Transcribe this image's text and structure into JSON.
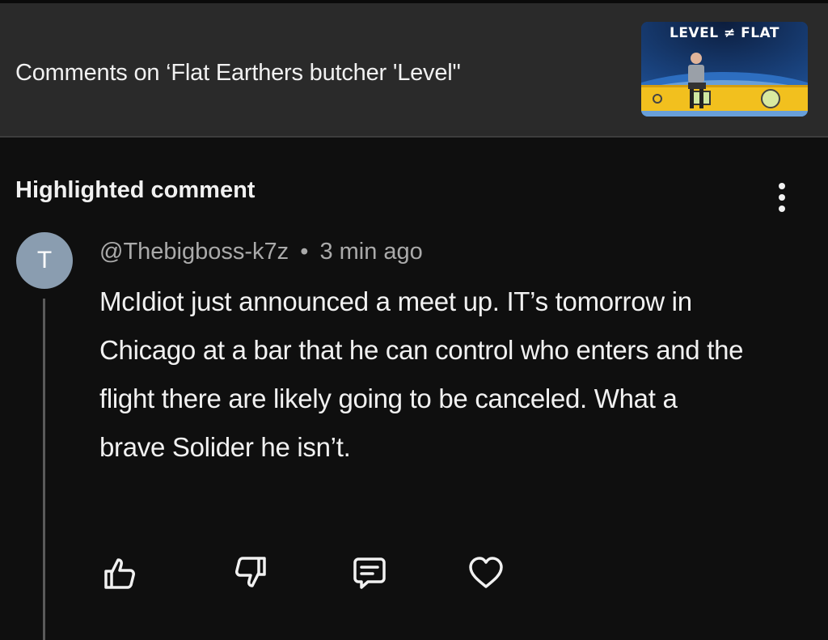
{
  "header": {
    "title": "Comments on ‘Flat Earthers butcher 'Level\"",
    "thumbnail": {
      "text": "LEVEL ≠ FLAT"
    }
  },
  "section": {
    "title": "Highlighted comment"
  },
  "comment": {
    "avatar_letter": "T",
    "author": "@Thebigboss-k7z",
    "separator": "•",
    "time": "3 min ago",
    "text": "McIdiot just announced a meet up. IT’s tomorrow in Chicago at a bar that he can control who enters and the flight there are likely going to be canceled. What a brave Solider he isn’t."
  },
  "actions": {
    "icons": [
      "thumbs-up-icon",
      "thumbs-down-icon",
      "reply-icon",
      "heart-icon"
    ]
  },
  "colors": {
    "background": "#0f0f0f",
    "header_bg": "#2a2a2a",
    "avatar_bg": "#8a9db0",
    "meta_text": "#aaaaaa"
  }
}
